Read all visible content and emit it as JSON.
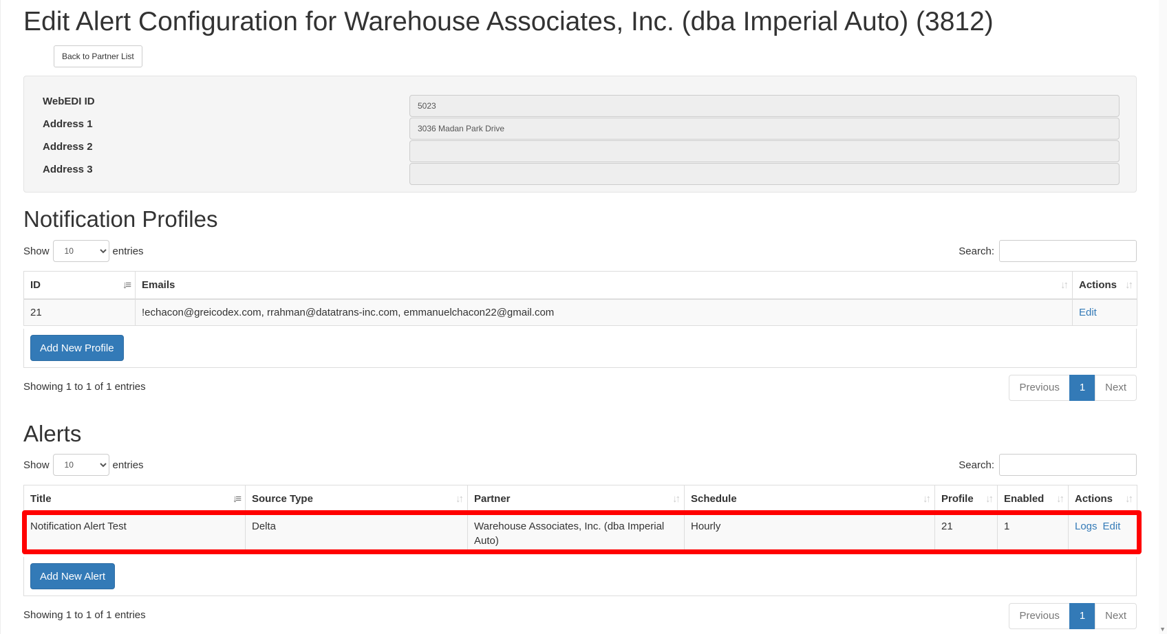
{
  "page": {
    "title": "Edit Alert Configuration for Warehouse Associates, Inc. (dba Imperial Auto) (3812)",
    "back_label": "Back to Partner List"
  },
  "info": {
    "webedi_label": "WebEDI ID",
    "webedi_value": "5023",
    "address1_label": "Address 1",
    "address1_value": "3036 Madan Park Drive",
    "address2_label": "Address 2",
    "address2_value": "",
    "address3_label": "Address 3",
    "address3_value": ""
  },
  "profiles": {
    "heading": "Notification Profiles",
    "show_label": "Show",
    "entries_label": "entries",
    "page_length": "10",
    "search_label": "Search:",
    "columns": {
      "id": "ID",
      "emails": "Emails",
      "actions": "Actions"
    },
    "rows": [
      {
        "id": "21",
        "emails": "!echacon@greicodex.com, rrahman@datatrans-inc.com, emmanuelchacon22@gmail.com",
        "edit": "Edit"
      }
    ],
    "add_label": "Add New Profile",
    "info_text": "Showing 1 to 1 of 1 entries",
    "prev_label": "Previous",
    "page_num": "1",
    "next_label": "Next"
  },
  "alerts": {
    "heading": "Alerts",
    "show_label": "Show",
    "entries_label": "entries",
    "page_length": "10",
    "search_label": "Search:",
    "columns": {
      "title": "Title",
      "source_type": "Source Type",
      "partner": "Partner",
      "schedule": "Schedule",
      "profile": "Profile",
      "enabled": "Enabled",
      "actions": "Actions"
    },
    "rows": [
      {
        "title": "Notification Alert Test",
        "source_type": "Delta",
        "partner": "Warehouse Associates, Inc. (dba Imperial Auto)",
        "schedule": "Hourly",
        "profile": "21",
        "enabled": "1",
        "logs": "Logs",
        "edit": "Edit"
      }
    ],
    "add_label": "Add New Alert",
    "info_text": "Showing 1 to 1 of 1 entries",
    "prev_label": "Previous",
    "page_num": "1",
    "next_label": "Next"
  },
  "colors": {
    "accent": "#337ab7",
    "highlight": "#ff0000"
  },
  "icons": {
    "sort_active": "sort-amount-down-icon",
    "sort_inactive": "sort-both-icon"
  }
}
